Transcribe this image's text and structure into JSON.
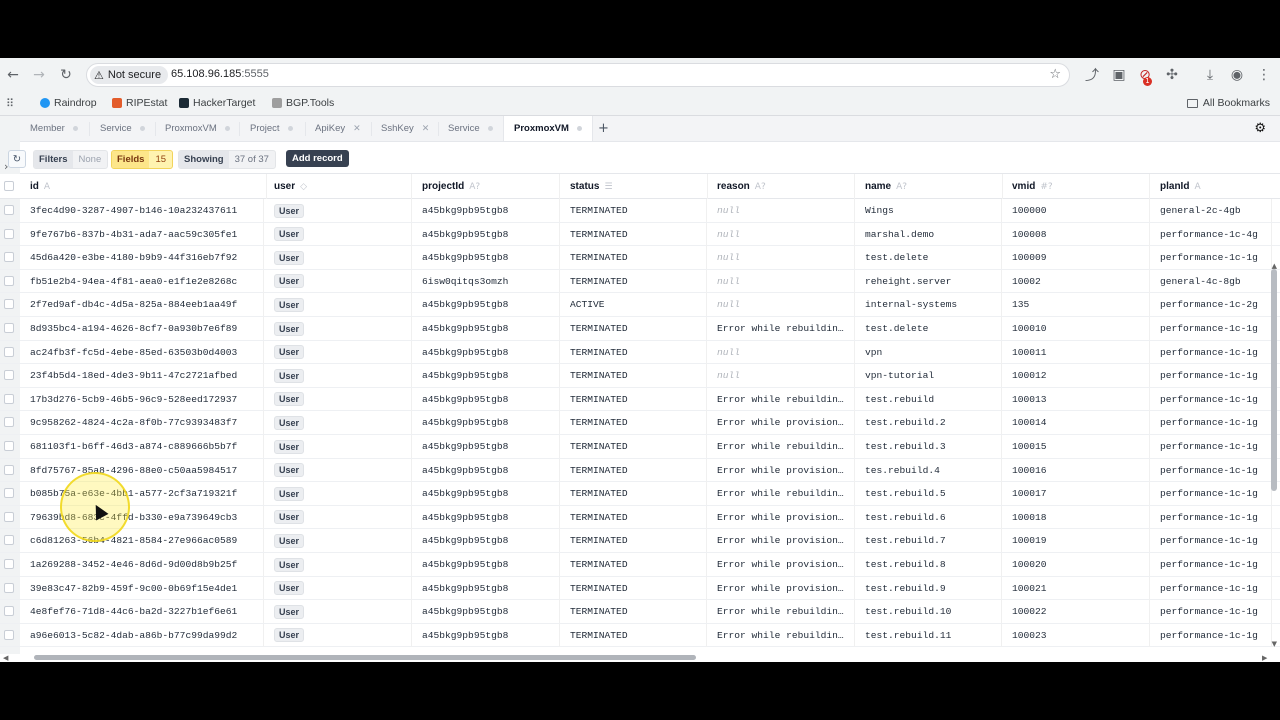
{
  "browser": {
    "security_label": "Not secure",
    "url_host": "65.108.96.185",
    "url_port": ":5555",
    "extension_badge": "1"
  },
  "bookmarks": {
    "items": [
      {
        "label": "Raindrop",
        "color": "#2196f3"
      },
      {
        "label": "RIPEstat",
        "color": "#e35c2b"
      },
      {
        "label": "HackerTarget",
        "color": "#1b2a35"
      },
      {
        "label": "BGP.Tools",
        "color": "#9e9e9e"
      }
    ],
    "all_label": "All Bookmarks"
  },
  "tabs": [
    {
      "label": "Member",
      "closable": false
    },
    {
      "label": "Service",
      "closable": false
    },
    {
      "label": "ProxmoxVM",
      "closable": false
    },
    {
      "label": "Project",
      "closable": false
    },
    {
      "label": "ApiKey",
      "closable": true
    },
    {
      "label": "SshKey",
      "closable": true
    },
    {
      "label": "Service",
      "closable": false
    },
    {
      "label": "ProxmoxVM",
      "closable": false,
      "active": true
    }
  ],
  "toolbar": {
    "filters_label": "Filters",
    "filters_value": "None",
    "fields_label": "Fields",
    "fields_value": "15",
    "showing_label": "Showing",
    "showing_value": "37 of 37",
    "add_record_label": "Add record"
  },
  "columns": [
    {
      "label": "id",
      "type_icon": "A"
    },
    {
      "label": "user",
      "type_icon": "◇"
    },
    {
      "label": "projectId",
      "type_icon": "A?"
    },
    {
      "label": "status",
      "type_icon": "☰"
    },
    {
      "label": "reason",
      "type_icon": "A?"
    },
    {
      "label": "name",
      "type_icon": "A?"
    },
    {
      "label": "vmid",
      "type_icon": "#?"
    },
    {
      "label": "planId",
      "type_icon": "A"
    }
  ],
  "rows": [
    {
      "id": "3fec4d90-3287-4907-b146-10a232437611",
      "user": "User",
      "projectId": "a45bkg9pb95tgb8",
      "status": "TERMINATED",
      "reason": "null",
      "name": "Wings",
      "vmid": "100000",
      "planId": "general-2c-4gb"
    },
    {
      "id": "9fe767b6-837b-4b31-ada7-aac59c305fe1",
      "user": "User",
      "projectId": "a45bkg9pb95tgb8",
      "status": "TERMINATED",
      "reason": "null",
      "name": "marshal.demo",
      "vmid": "100008",
      "planId": "performance-1c-4g"
    },
    {
      "id": "45d6a420-e3be-4180-b9b9-44f316eb7f92",
      "user": "User",
      "projectId": "a45bkg9pb95tgb8",
      "status": "TERMINATED",
      "reason": "null",
      "name": "test.delete",
      "vmid": "100009",
      "planId": "performance-1c-1g"
    },
    {
      "id": "fb51e2b4-94ea-4f81-aea0-e1f1e2e8268c",
      "user": "User",
      "projectId": "6isw0qitqs3omzh",
      "status": "TERMINATED",
      "reason": "null",
      "name": "reheight.server",
      "vmid": "10002",
      "planId": "general-4c-8gb"
    },
    {
      "id": "2f7ed9af-db4c-4d5a-825a-884eeb1aa49f",
      "user": "User",
      "projectId": "a45bkg9pb95tgb8",
      "status": "ACTIVE",
      "reason": "null",
      "name": "internal-systems",
      "vmid": "135",
      "planId": "performance-1c-2g"
    },
    {
      "id": "8d935bc4-a194-4626-8cf7-0a930b7e6f89",
      "user": "User",
      "projectId": "a45bkg9pb95tgb8",
      "status": "TERMINATED",
      "reason": "Error while rebuildin…",
      "name": "test.delete",
      "vmid": "100010",
      "planId": "performance-1c-1g"
    },
    {
      "id": "ac24fb3f-fc5d-4ebe-85ed-63503b0d4003",
      "user": "User",
      "projectId": "a45bkg9pb95tgb8",
      "status": "TERMINATED",
      "reason": "null",
      "name": "vpn",
      "vmid": "100011",
      "planId": "performance-1c-1g"
    },
    {
      "id": "23f4b5d4-18ed-4de3-9b11-47c2721afbed",
      "user": "User",
      "projectId": "a45bkg9pb95tgb8",
      "status": "TERMINATED",
      "reason": "null",
      "name": "vpn-tutorial",
      "vmid": "100012",
      "planId": "performance-1c-1g"
    },
    {
      "id": "17b3d276-5cb9-46b5-96c9-528eed172937",
      "user": "User",
      "projectId": "a45bkg9pb95tgb8",
      "status": "TERMINATED",
      "reason": "Error while rebuildin…",
      "name": "test.rebuild",
      "vmid": "100013",
      "planId": "performance-1c-1g"
    },
    {
      "id": "9c958262-4824-4c2a-8f0b-77c9393483f7",
      "user": "User",
      "projectId": "a45bkg9pb95tgb8",
      "status": "TERMINATED",
      "reason": "Error while provision…",
      "name": "test.rebuild.2",
      "vmid": "100014",
      "planId": "performance-1c-1g"
    },
    {
      "id": "681103f1-b6ff-46d3-a874-c889666b5b7f",
      "user": "User",
      "projectId": "a45bkg9pb95tgb8",
      "status": "TERMINATED",
      "reason": "Error while rebuildin…",
      "name": "test.rebuild.3",
      "vmid": "100015",
      "planId": "performance-1c-1g"
    },
    {
      "id": "8fd75767-85a8-4296-88e0-c50aa5984517",
      "user": "User",
      "projectId": "a45bkg9pb95tgb8",
      "status": "TERMINATED",
      "reason": "Error while provision…",
      "name": "tes.rebuild.4",
      "vmid": "100016",
      "planId": "performance-1c-1g"
    },
    {
      "id": "b085b75a-e63e-4bb1-a577-2cf3a719321f",
      "user": "User",
      "projectId": "a45bkg9pb95tgb8",
      "status": "TERMINATED",
      "reason": "Error while rebuildin…",
      "name": "test.rebuild.5",
      "vmid": "100017",
      "planId": "performance-1c-1g"
    },
    {
      "id": "79639bd8-683c-4ffd-b330-e9a739649cb3",
      "user": "User",
      "projectId": "a45bkg9pb95tgb8",
      "status": "TERMINATED",
      "reason": "Error while provision…",
      "name": "test.rebuild.6",
      "vmid": "100018",
      "planId": "performance-1c-1g"
    },
    {
      "id": "c6d81263-56b4-4821-8584-27e966ac0589",
      "user": "User",
      "projectId": "a45bkg9pb95tgb8",
      "status": "TERMINATED",
      "reason": "Error while provision…",
      "name": "test.rebuild.7",
      "vmid": "100019",
      "planId": "performance-1c-1g"
    },
    {
      "id": "1a269288-3452-4e46-8d6d-9d00d8b9b25f",
      "user": "User",
      "projectId": "a45bkg9pb95tgb8",
      "status": "TERMINATED",
      "reason": "Error while provision…",
      "name": "test.rebuild.8",
      "vmid": "100020",
      "planId": "performance-1c-1g"
    },
    {
      "id": "39e83c47-82b9-459f-9c00-0b69f15e4de1",
      "user": "User",
      "projectId": "a45bkg9pb95tgb8",
      "status": "TERMINATED",
      "reason": "Error while provision…",
      "name": "test.rebuild.9",
      "vmid": "100021",
      "planId": "performance-1c-1g"
    },
    {
      "id": "4e8fef76-71d8-44c6-ba2d-3227b1ef6e61",
      "user": "User",
      "projectId": "a45bkg9pb95tgb8",
      "status": "TERMINATED",
      "reason": "Error while rebuildin…",
      "name": "test.rebuild.10",
      "vmid": "100022",
      "planId": "performance-1c-1g"
    },
    {
      "id": "a96e6013-5c82-4dab-a86b-b77c99da99d2",
      "user": "User",
      "projectId": "a45bkg9pb95tgb8",
      "status": "TERMINATED",
      "reason": "Error while rebuildin…",
      "name": "test.rebuild.11",
      "vmid": "100023",
      "planId": "performance-1c-1g"
    }
  ]
}
